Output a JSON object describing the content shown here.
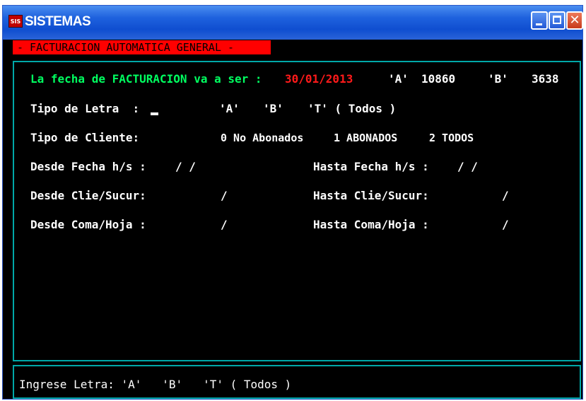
{
  "window": {
    "title": "SISTEMAS",
    "icon": "app-logo-icon",
    "buttons": [
      "minimize-icon",
      "maximize-icon",
      "close-icon"
    ]
  },
  "mode_label": "- FACTURACION AUTOMATICA GENERAL -",
  "header": {
    "fecha_label": "La fecha de FACTURACION va a ser : ",
    "fecha_value": "30/01/2013",
    "a_label": "'A'",
    "a_value": "10860",
    "b_label": "'B'",
    "b_value": "3638"
  },
  "tipo_letra": {
    "label": "Tipo de Letra  :",
    "value": "",
    "options": [
      "'A'",
      "'B'",
      "'T' ( Todos )"
    ]
  },
  "tipo_cliente": {
    "label": "Tipo de Cliente:",
    "options": [
      "0 No Abonados",
      "1 ABONADOS",
      "2 TODOS"
    ]
  },
  "desde_fecha": {
    "label": "Desde Fecha h/s :",
    "value": "/ /"
  },
  "hasta_fecha": {
    "label": "Hasta Fecha h/s :",
    "value": "/ /"
  },
  "desde_clie": {
    "label": "Desde Clie/Sucur:",
    "value": "/"
  },
  "hasta_clie": {
    "label": "Hasta Clie/Sucur:",
    "value": "/"
  },
  "desde_coma": {
    "label": "Desde Coma/Hoja :",
    "value": "/"
  },
  "hasta_coma": {
    "label": "Hasta Coma/Hoja :",
    "value": "/"
  },
  "footer": {
    "prompt": "Ingrese Letra: 'A'   'B'   'T' ( Todos )"
  },
  "colors": {
    "background": "#000000",
    "text": "#ffffff",
    "highlight": "#00ff60",
    "date": "#ff1a1a",
    "mode_label_bg": "#ff0000",
    "panel_border": "#00a8a8",
    "titlebar": "#1f62de"
  }
}
